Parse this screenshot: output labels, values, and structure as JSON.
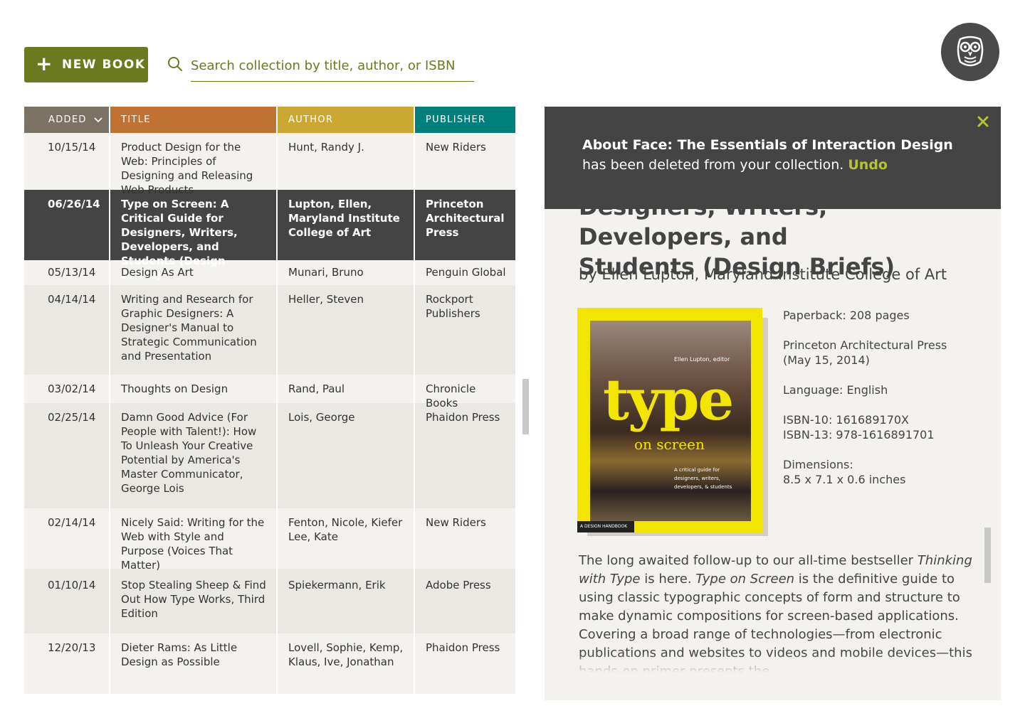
{
  "toolbar": {
    "new_book_label": "NEW BOOK",
    "search_placeholder": "Search collection by title, author, or ISBN",
    "accent_color": "#6c7a1f"
  },
  "table": {
    "headers": {
      "added": "ADDED",
      "title": "TITLE",
      "author": "AUTHOR",
      "publisher": "PUBLISHER"
    },
    "header_colors": {
      "added": "#7c7165",
      "title": "#c07233",
      "author": "#cba833",
      "publisher": "#007f7c"
    },
    "rows": [
      {
        "added": "10/15/14",
        "title": "Product Design for the Web: Principles of Designing and Releasing Web Products",
        "author": "Hunt, Randy J.",
        "publisher": "New Riders"
      },
      {
        "added": "06/26/14",
        "title": "Type on Screen: A Critical Guide for Designers, Writers, Developers, and Students (Design Briefs)",
        "author": "Lupton, Ellen, Maryland Institute College of Art",
        "publisher": "Princeton Architectural Press",
        "selected": true
      },
      {
        "added": "05/13/14",
        "title": "Design As Art",
        "author": "Munari, Bruno",
        "publisher": "Penguin Global"
      },
      {
        "added": "04/14/14",
        "title": "Writing and Research for Graphic Designers: A Designer's Manual to Strategic Communication and Presentation",
        "author": "Heller, Steven",
        "publisher": "Rockport Publishers"
      },
      {
        "added": "03/02/14",
        "title": "Thoughts on Design",
        "author": "Rand, Paul",
        "publisher": "Chronicle Books"
      },
      {
        "added": "02/25/14",
        "title": "Damn Good Advice (For People with Talent!): How To Unleash Your Creative Potential by America's Master Communicator, George Lois",
        "author": "Lois, George",
        "publisher": "Phaidon Press"
      },
      {
        "added": "02/14/14",
        "title": "Nicely Said: Writing for the Web with Style and Purpose (Voices That Matter)",
        "author": "Fenton, Nicole, Kiefer Lee, Kate",
        "publisher": "New Riders"
      },
      {
        "added": "01/10/14",
        "title": "Stop Stealing Sheep & Find Out How Type Works, Third Edition",
        "author": "Spiekermann, Erik",
        "publisher": "Adobe Press"
      },
      {
        "added": "12/20/13",
        "title": "Dieter Rams: As Little Design as Possible",
        "author": "Lovell, Sophie, Kemp, Klaus, Ive, Jonathan",
        "publisher": "Phaidon Press"
      }
    ]
  },
  "notice": {
    "book_title": "About Face: The Essentials of Interaction Design",
    "message": "has been deleted from your collection.",
    "undo_label": "Undo"
  },
  "detail": {
    "title_partial_top": "Designers, Writers, Developers, and",
    "title_bottom": "Students (Design Briefs)",
    "byline": "by Ellen Lupton, Maryland Institute College of Art",
    "cover": {
      "author_text": "Ellen Lupton, editor",
      "word1": "type",
      "word2": "on screen",
      "blurb": "A critical guide for designers, writers, developers, & students",
      "series": "A DESIGN HANDBOOK"
    },
    "format": "Paperback: 208 pages",
    "publisher_line": "Princeton Architectural Press",
    "date_line": "(May 15, 2014)",
    "language": "Language: English",
    "isbn10": "ISBN-10: 161689170X",
    "isbn13": "ISBN-13: 978-1616891701",
    "dimensions_label": "Dimensions:",
    "dimensions_value": "8.5 x 7.1 x 0.6 inches",
    "description": {
      "p1": "The long awaited follow-up to our all-time bestseller ",
      "i1": "Thinking with Type",
      "p2": " is here. ",
      "i2": "Type on Screen",
      "p3": " is the definitive guide to using classic typographic concepts of form and structure to make dynamic compositions for screen-based applications. Covering a broad range of technologies—from electronic publications and websites to videos and mobile devices—this hands-on primer presents the"
    }
  }
}
